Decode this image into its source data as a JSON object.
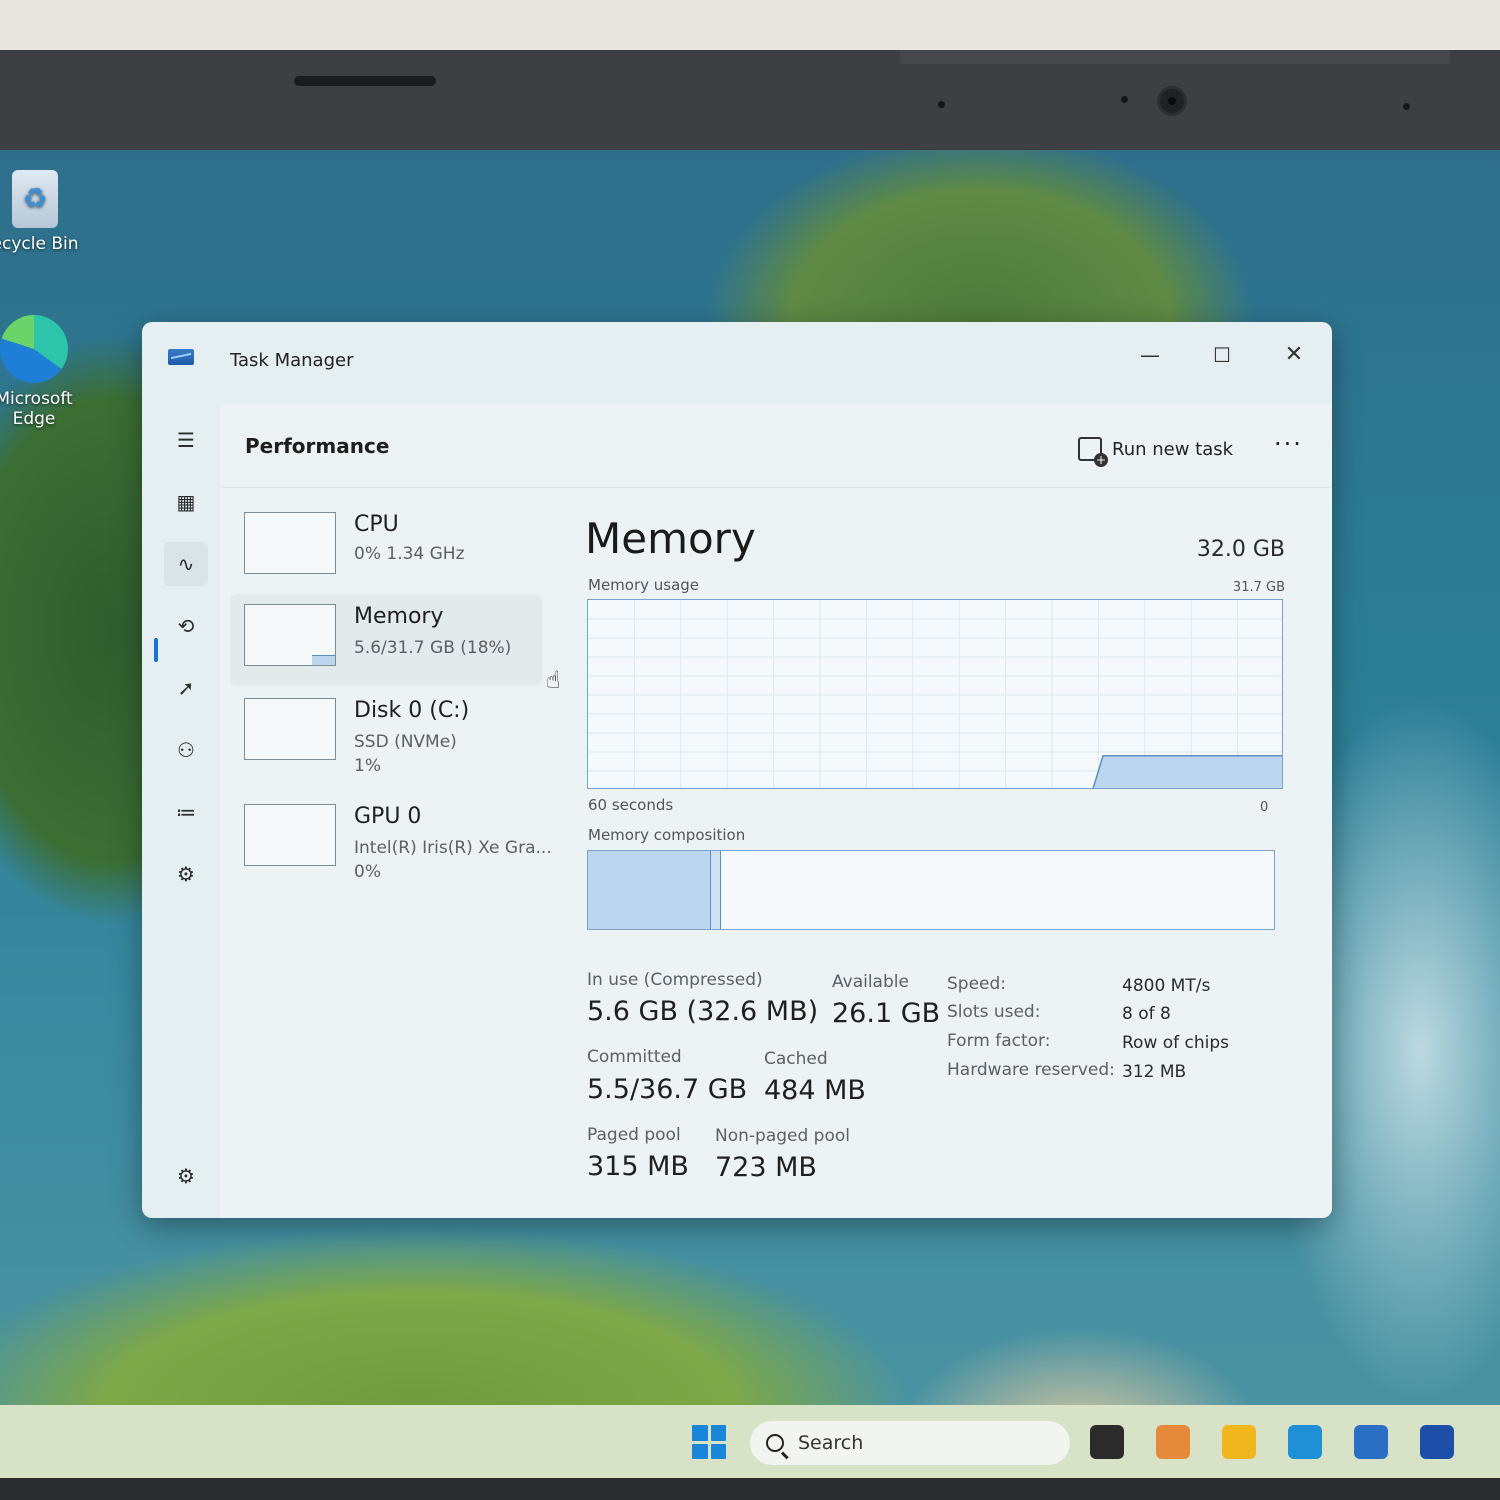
{
  "desktop": {
    "icons": [
      {
        "label": "ecycle Bin",
        "icon": "recycle-bin-icon"
      },
      {
        "label": "Microsoft\nEdge",
        "icon": "edge-icon"
      }
    ]
  },
  "window": {
    "title": "Task Manager",
    "controls": {
      "minimize": "—",
      "maximize": "☐",
      "close": "✕"
    }
  },
  "nav": {
    "items": [
      {
        "name": "hamburger-menu",
        "icon": "☰"
      },
      {
        "name": "processes",
        "icon": "▦"
      },
      {
        "name": "performance",
        "icon": "∿",
        "active": true
      },
      {
        "name": "app-history",
        "icon": "⟲"
      },
      {
        "name": "startup-apps",
        "icon": "➚"
      },
      {
        "name": "users",
        "icon": "⚇"
      },
      {
        "name": "details",
        "icon": "≔"
      },
      {
        "name": "services",
        "icon": "⚙"
      }
    ],
    "settings_icon": "⚙"
  },
  "header": {
    "title": "Performance",
    "run_new_task": "Run new task",
    "more": "···"
  },
  "devices": [
    {
      "name": "CPU",
      "line1": "0% 1.34 GHz",
      "line2": ""
    },
    {
      "name": "Memory",
      "line1": "5.6/31.7 GB (18%)",
      "line2": "",
      "selected": true
    },
    {
      "name": "Disk 0 (C:)",
      "line1": "SSD (NVMe)",
      "line2": "1%"
    },
    {
      "name": "GPU 0",
      "line1": "Intel(R) Iris(R) Xe Gra...",
      "line2": "0%"
    }
  ],
  "memory": {
    "title": "Memory",
    "total": "32.0 GB",
    "usage_label": "Memory usage",
    "usage_max": "31.7 GB",
    "time_label": "60 seconds",
    "min_label": "0",
    "composition_label": "Memory composition",
    "in_use_fraction": 0.18,
    "stats": {
      "in_use_label": "In use (Compressed)",
      "in_use_value": "5.6 GB (32.6 MB)",
      "available_label": "Available",
      "available_value": "26.1 GB",
      "committed_label": "Committed",
      "committed_value": "5.5/36.7 GB",
      "cached_label": "Cached",
      "cached_value": "484 MB",
      "paged_label": "Paged pool",
      "paged_value": "315 MB",
      "nonpaged_label": "Non-paged pool",
      "nonpaged_value": "723 MB"
    },
    "specs": [
      {
        "label": "Speed:",
        "value": "4800 MT/s"
      },
      {
        "label": "Slots used:",
        "value": "8 of 8"
      },
      {
        "label": "Form factor:",
        "value": "Row of chips"
      },
      {
        "label": "Hardware reserved:",
        "value": "312 MB"
      }
    ]
  },
  "taskbar": {
    "search_label": "Search",
    "apps": [
      {
        "name": "task-view",
        "color": "#2b2b2b"
      },
      {
        "name": "copilot",
        "color": "#e58a3a"
      },
      {
        "name": "file-explorer",
        "color": "#f2b61f"
      },
      {
        "name": "edge",
        "color": "#1f8fd6"
      },
      {
        "name": "store",
        "color": "#2a6fc4"
      },
      {
        "name": "b-app",
        "color": "#1d4fa8"
      }
    ]
  }
}
